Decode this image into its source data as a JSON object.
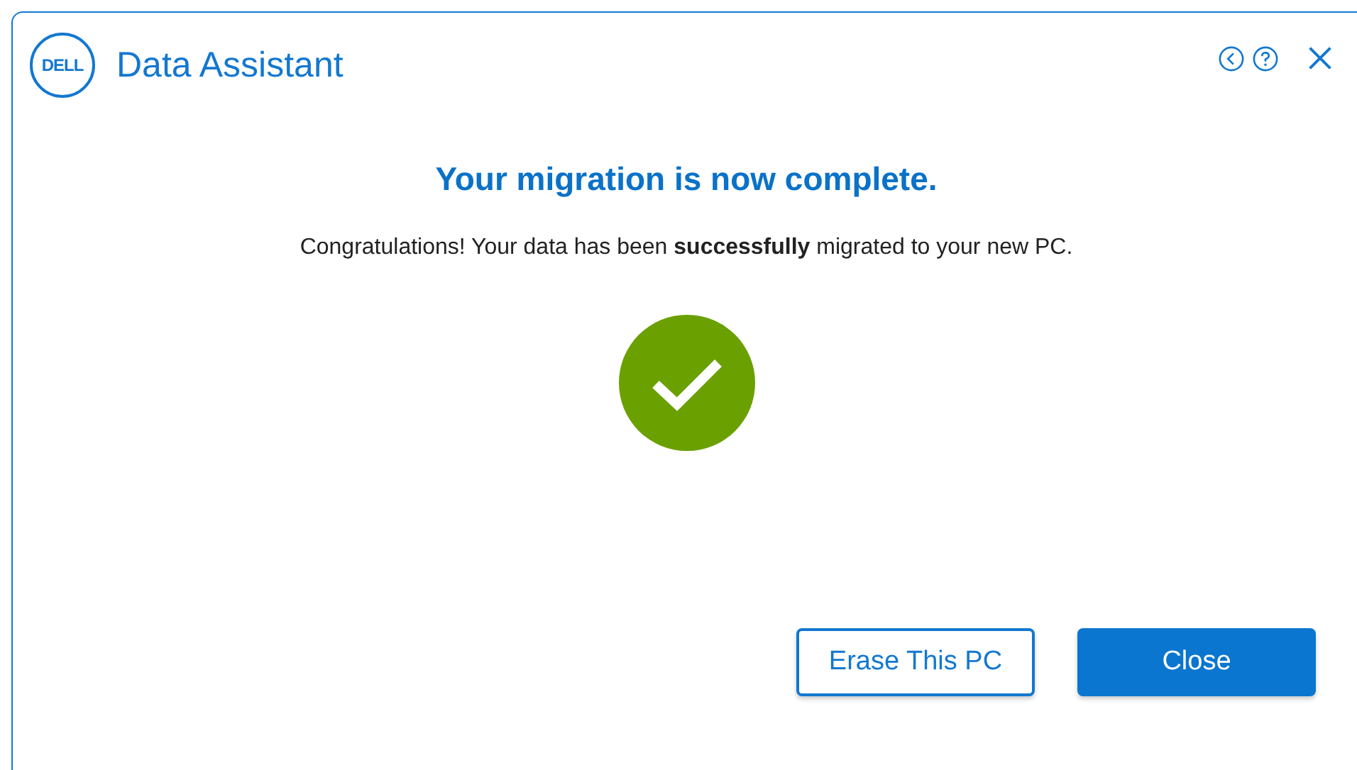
{
  "window": {
    "logo": "DELL",
    "title": "Data Assistant"
  },
  "heading": "Your migration is now complete.",
  "message": "Congratulations! Your data has been **successfully** migrated to your new PC.",
  "buttons": [
    {
      "label": "Erase This PC",
      "kind": "secondary"
    },
    {
      "label": "Close",
      "kind": "primary"
    }
  ]
}
